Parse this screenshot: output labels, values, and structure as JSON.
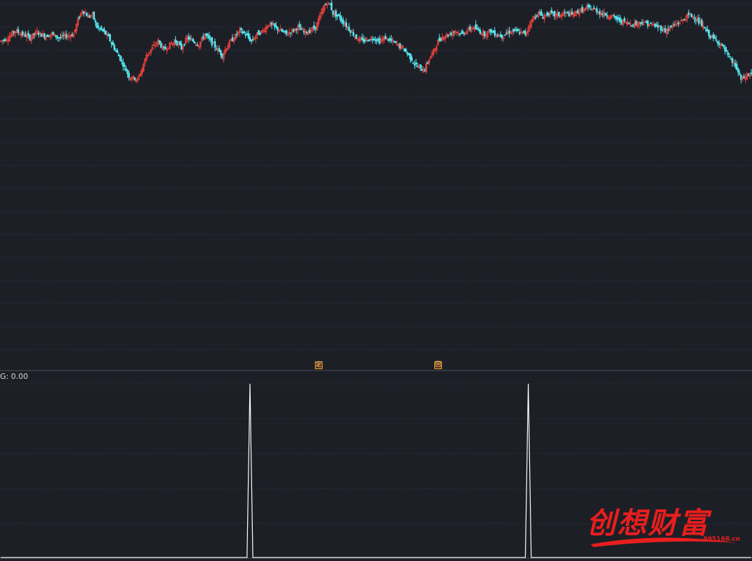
{
  "indicator": {
    "label": "G: 0.00"
  },
  "markers": [
    {
      "id": "ding",
      "text": "定"
    },
    {
      "id": "hui",
      "text": "回"
    }
  ],
  "watermark": {
    "text": "创想财富",
    "url": "995168.cn"
  },
  "colors": {
    "background": "#1c1f26",
    "up": "#e8413c",
    "down": "#54e7f0",
    "grid": "#3a3f4a",
    "indicator_line": "#ffffff",
    "watermark": "#e81e1e"
  },
  "chart_data": [
    {
      "type": "candlestick",
      "panel": "price",
      "title": "",
      "grid": "horizontal-dotted",
      "ylim": [
        0,
        100
      ],
      "note_units": "relative price scale (no axis labels shown)",
      "close_path": [
        [
          0,
          78
        ],
        [
          5,
          80
        ],
        [
          10,
          84
        ],
        [
          15,
          82
        ],
        [
          20,
          80
        ],
        [
          25,
          83
        ],
        [
          30,
          81
        ],
        [
          35,
          82
        ],
        [
          40,
          80
        ],
        [
          45,
          81
        ],
        [
          50,
          82
        ],
        [
          53,
          90
        ],
        [
          56,
          96
        ],
        [
          58,
          94
        ],
        [
          60,
          92
        ],
        [
          63,
          93
        ],
        [
          66,
          86
        ],
        [
          70,
          84
        ],
        [
          74,
          80
        ],
        [
          78,
          74
        ],
        [
          82,
          68
        ],
        [
          85,
          63
        ],
        [
          88,
          58
        ],
        [
          91,
          57
        ],
        [
          94,
          56
        ],
        [
          97,
          62
        ],
        [
          100,
          70
        ],
        [
          104,
          74
        ],
        [
          108,
          78
        ],
        [
          112,
          73
        ],
        [
          116,
          76
        ],
        [
          120,
          78
        ],
        [
          124,
          74
        ],
        [
          128,
          80
        ],
        [
          132,
          78
        ],
        [
          136,
          76
        ],
        [
          140,
          82
        ],
        [
          144,
          78
        ],
        [
          148,
          74
        ],
        [
          152,
          70
        ],
        [
          156,
          76
        ],
        [
          160,
          80
        ],
        [
          164,
          84
        ],
        [
          168,
          82
        ],
        [
          172,
          78
        ],
        [
          176,
          82
        ],
        [
          180,
          84
        ],
        [
          184,
          88
        ],
        [
          188,
          86
        ],
        [
          192,
          84
        ],
        [
          196,
          82
        ],
        [
          200,
          84
        ],
        [
          204,
          86
        ],
        [
          208,
          83
        ],
        [
          212,
          84
        ],
        [
          216,
          86
        ],
        [
          219,
          92
        ],
        [
          222,
          98
        ],
        [
          224,
          100
        ],
        [
          226,
          99
        ],
        [
          228,
          94
        ],
        [
          232,
          92
        ],
        [
          236,
          88
        ],
        [
          240,
          84
        ],
        [
          244,
          80
        ],
        [
          248,
          78
        ],
        [
          252,
          79
        ],
        [
          256,
          80
        ],
        [
          260,
          78
        ],
        [
          264,
          80
        ],
        [
          268,
          78
        ],
        [
          272,
          76
        ],
        [
          276,
          74
        ],
        [
          280,
          70
        ],
        [
          284,
          65
        ],
        [
          288,
          62
        ],
        [
          291,
          62
        ],
        [
          294,
          68
        ],
        [
          297,
          72
        ],
        [
          300,
          78
        ],
        [
          304,
          81
        ],
        [
          308,
          82
        ],
        [
          312,
          84
        ],
        [
          316,
          82
        ],
        [
          320,
          84
        ],
        [
          324,
          86
        ],
        [
          328,
          84
        ],
        [
          332,
          82
        ],
        [
          336,
          84
        ],
        [
          340,
          82
        ],
        [
          344,
          81
        ],
        [
          348,
          83
        ],
        [
          352,
          84
        ],
        [
          356,
          83
        ],
        [
          360,
          82
        ],
        [
          363,
          88
        ],
        [
          366,
          92
        ],
        [
          369,
          94
        ],
        [
          372,
          92
        ],
        [
          376,
          94
        ],
        [
          380,
          93
        ],
        [
          384,
          93
        ],
        [
          388,
          94
        ],
        [
          392,
          93
        ],
        [
          396,
          95
        ],
        [
          400,
          96
        ],
        [
          404,
          97
        ],
        [
          408,
          96
        ],
        [
          412,
          94
        ],
        [
          416,
          93
        ],
        [
          420,
          92
        ],
        [
          424,
          90
        ],
        [
          428,
          89
        ],
        [
          432,
          88
        ],
        [
          436,
          88
        ],
        [
          440,
          89
        ],
        [
          444,
          88
        ],
        [
          448,
          87
        ],
        [
          452,
          86
        ],
        [
          456,
          84
        ],
        [
          460,
          86
        ],
        [
          464,
          88
        ],
        [
          468,
          90
        ],
        [
          472,
          93
        ],
        [
          476,
          92
        ],
        [
          480,
          88
        ],
        [
          484,
          84
        ],
        [
          488,
          80
        ],
        [
          492,
          78
        ],
        [
          496,
          74
        ],
        [
          500,
          68
        ],
        [
          504,
          64
        ],
        [
          508,
          56
        ],
        [
          512,
          58
        ],
        [
          515,
          60
        ]
      ]
    },
    {
      "type": "line",
      "panel": "indicator",
      "title": "",
      "series": [
        {
          "name": "G",
          "values": [
            {
              "x": 0,
              "y": 0
            },
            {
              "x": 169,
              "y": 0
            },
            {
              "x": 171,
              "y": 100
            },
            {
              "x": 173,
              "y": 0
            },
            {
              "x": 360,
              "y": 0
            },
            {
              "x": 362,
              "y": 100
            },
            {
              "x": 364,
              "y": 0
            },
            {
              "x": 515,
              "y": 0
            }
          ]
        }
      ],
      "ylim": [
        0,
        100
      ],
      "grid": "horizontal-dotted"
    }
  ]
}
